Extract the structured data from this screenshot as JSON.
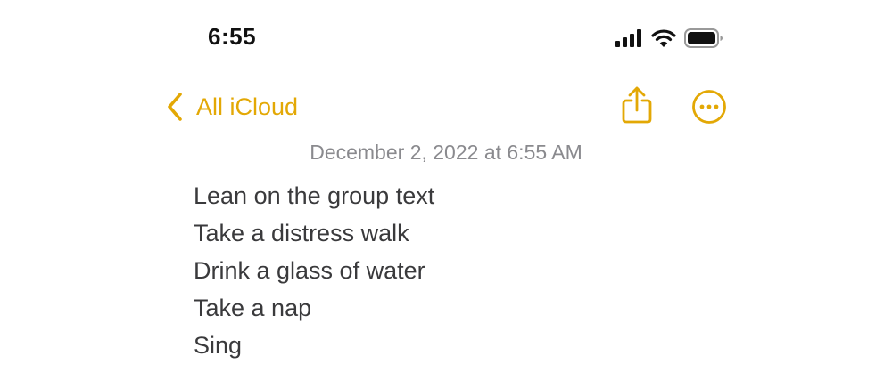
{
  "status_bar": {
    "time": "6:55",
    "icons": [
      "cellular-signal-icon",
      "wifi-icon",
      "battery-icon"
    ]
  },
  "nav": {
    "back_label": "All iCloud",
    "back_icon": "chevron-left-icon",
    "share_icon": "share-icon",
    "more_icon": "ellipsis-circle-icon"
  },
  "note": {
    "date": "December 2, 2022 at 6:55 AM",
    "lines": [
      "Lean on the group text",
      "Take a distress walk",
      "Drink a glass of water",
      "Take a nap",
      "Sing"
    ]
  },
  "colors": {
    "accent": "#e3a805",
    "text": "#3a3a3c",
    "secondary_text": "#8a8a8e",
    "background": "#ffffff"
  }
}
